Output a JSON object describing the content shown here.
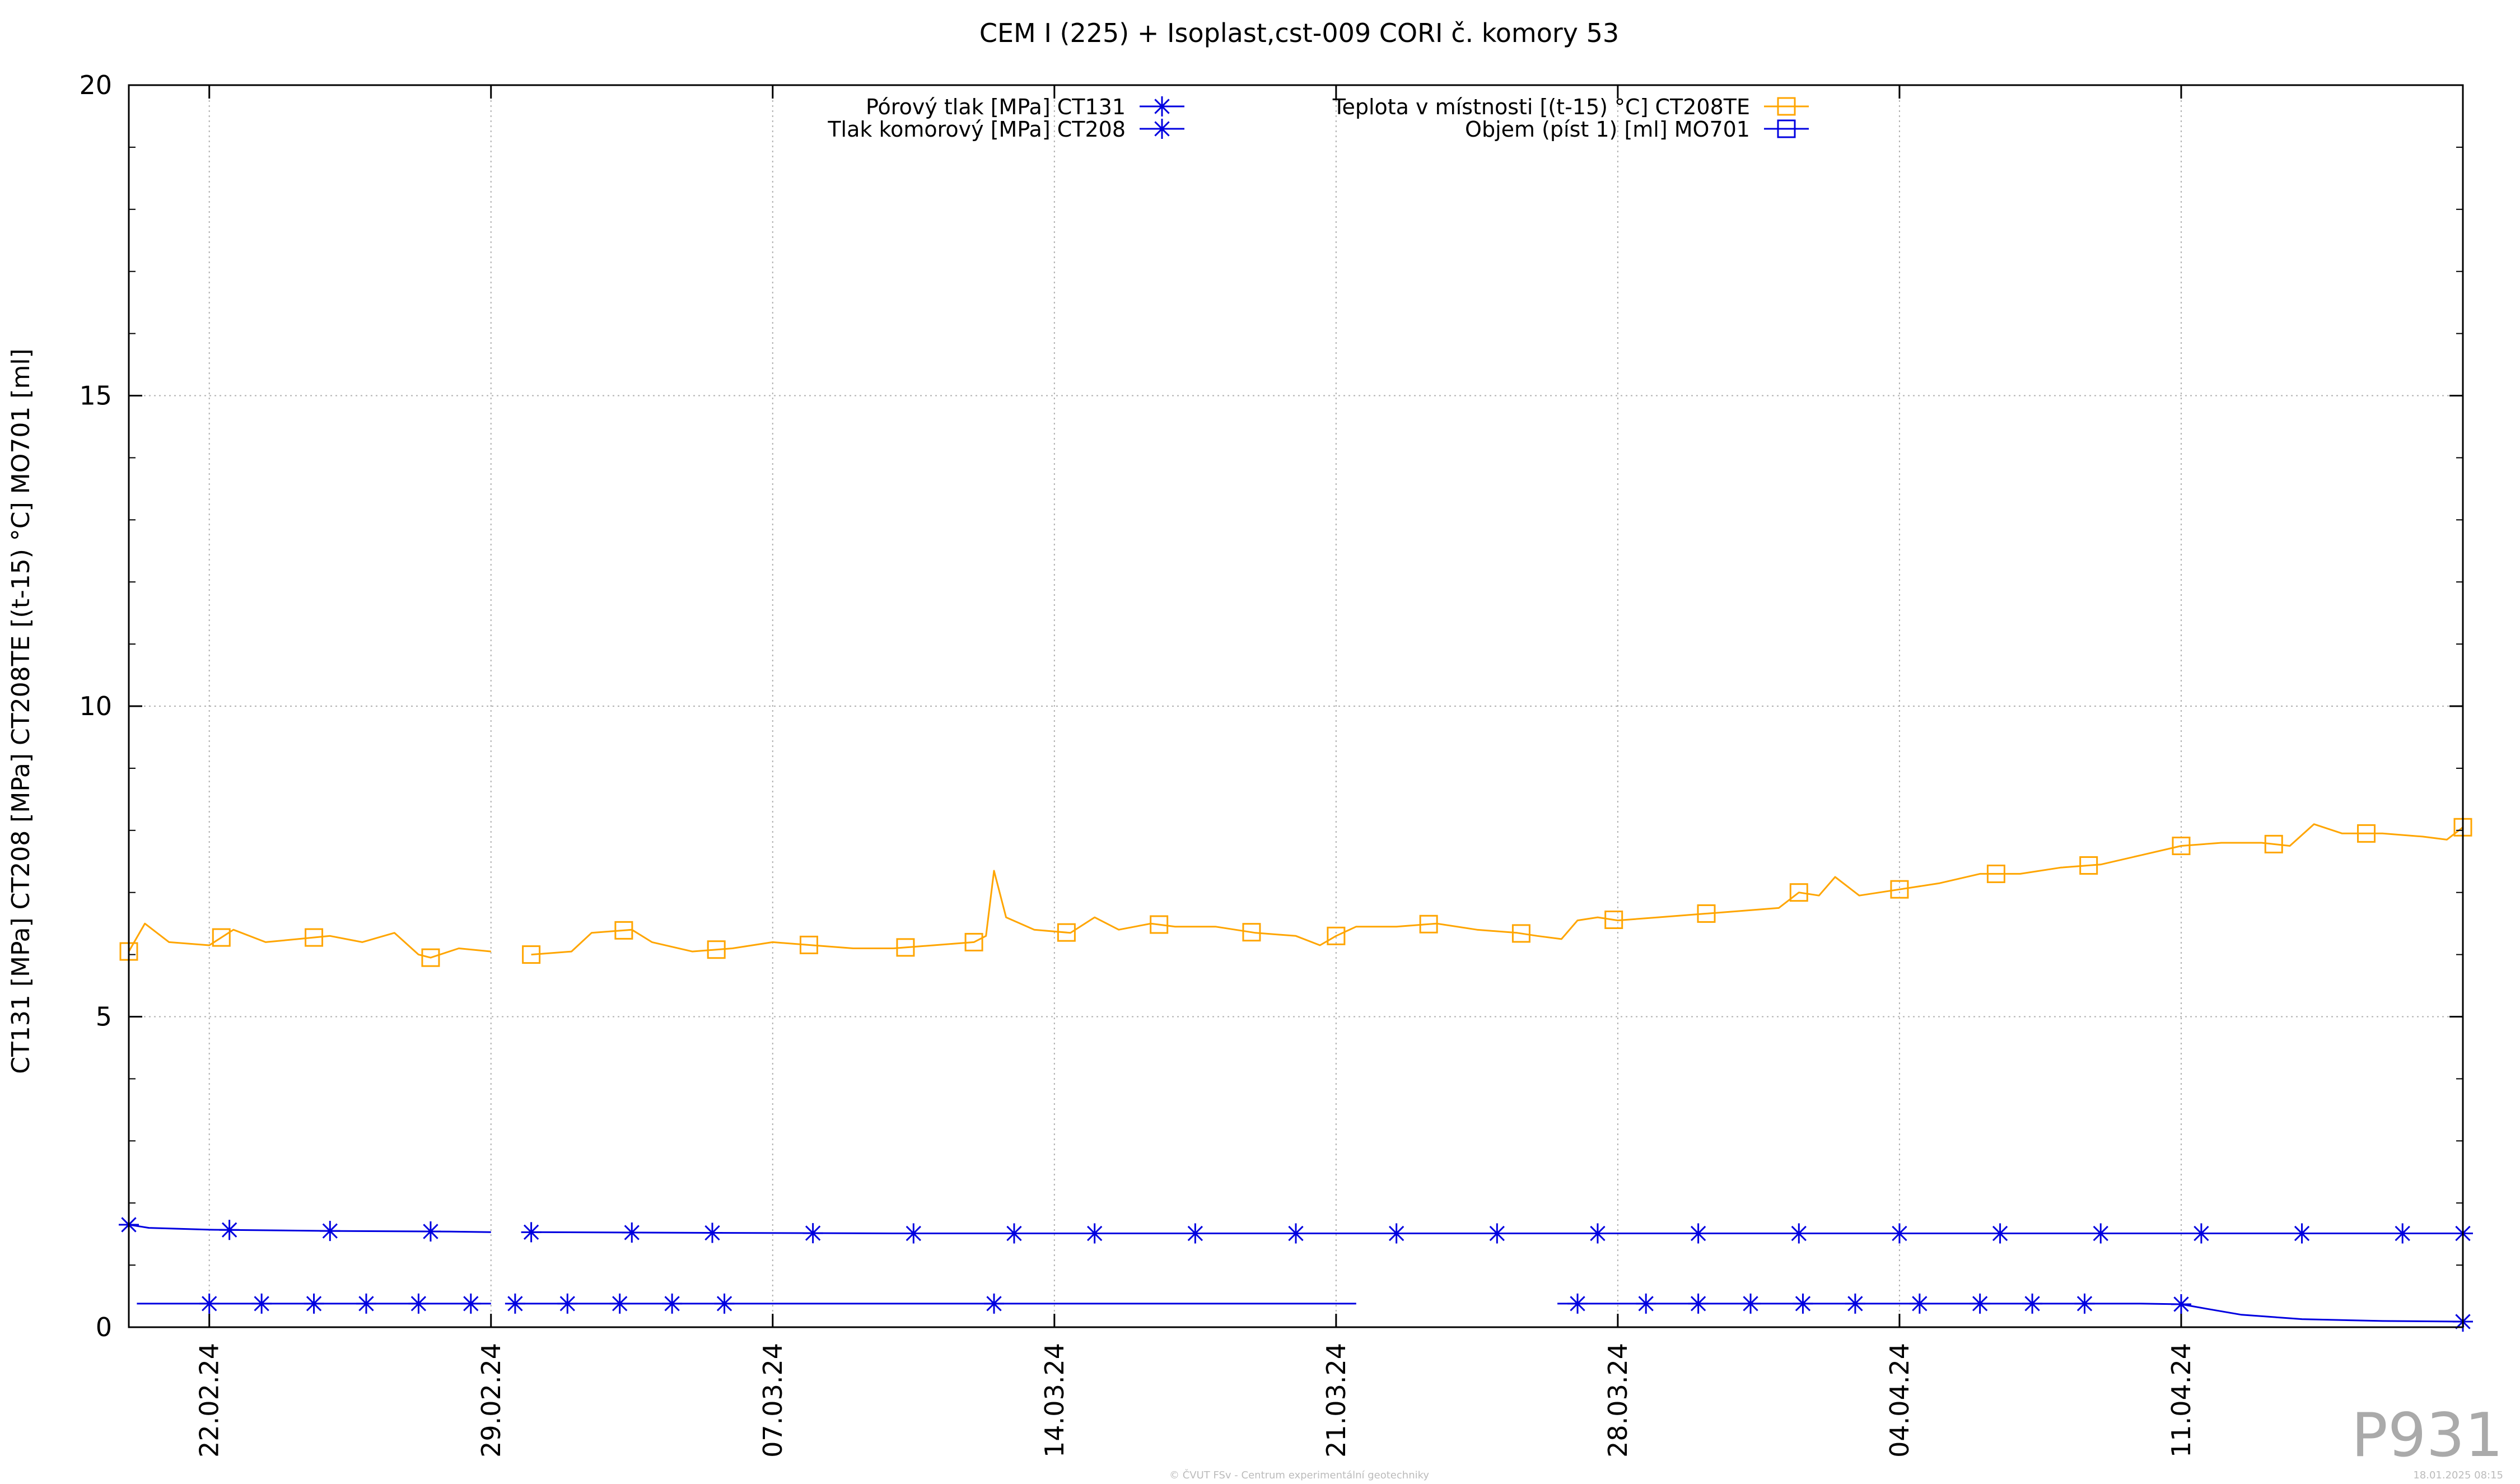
{
  "chart_data": {
    "type": "line",
    "title": "CEM I (225) + Isoplast,cst-009  CORI č. komory 53",
    "ylabel": "CT131 [MPa] CT208 [MPa] CT208TE [(t-15) °C] MO701 [ml]",
    "xlabel": "",
    "x_domain": [
      "2024-02-20",
      "2024-04-18"
    ],
    "ylim": [
      0,
      20
    ],
    "y_ticks": [
      0,
      5,
      10,
      15,
      20
    ],
    "x_ticks": [
      {
        "date": "2024-02-22",
        "label": "22.02.24"
      },
      {
        "date": "2024-02-29",
        "label": "29.02.24"
      },
      {
        "date": "2024-03-07",
        "label": "07.03.24"
      },
      {
        "date": "2024-03-14",
        "label": "14.03.24"
      },
      {
        "date": "2024-03-21",
        "label": "21.03.24"
      },
      {
        "date": "2024-03-28",
        "label": "28.03.24"
      },
      {
        "date": "2024-04-04",
        "label": "04.04.24"
      },
      {
        "date": "2024-04-11",
        "label": "11.04.24"
      }
    ],
    "grid": true,
    "legend_position": "top-center",
    "series": [
      {
        "name": "Pórový tlak [MPa] CT131",
        "color": "#0000e0",
        "marker": "asterisk",
        "legend_column": "left",
        "segments": [
          [
            [
              "2024-02-20",
              1.65
            ],
            [
              "2024-02-20.5",
              1.6
            ],
            [
              "2024-02-22",
              1.57
            ],
            [
              "2024-02-25",
              1.55
            ],
            [
              "2024-02-28",
              1.54
            ],
            [
              "2024-02-29",
              1.53
            ]
          ],
          [
            [
              "2024-03-01",
              1.53
            ],
            [
              "2024-03-05",
              1.52
            ],
            [
              "2024-03-10",
              1.51
            ],
            [
              "2024-03-15",
              1.51
            ],
            [
              "2024-03-20",
              1.51
            ],
            [
              "2024-03-25",
              1.51
            ],
            [
              "2024-04-01",
              1.51
            ],
            [
              "2024-04-08",
              1.51
            ],
            [
              "2024-04-14",
              1.51
            ],
            [
              "2024-04-18",
              1.51
            ]
          ]
        ],
        "markers_x": [
          "2024-02-20",
          "2024-02-22.5",
          "2024-02-25",
          "2024-02-27.5",
          "2024-03-01",
          "2024-03-03.5",
          "2024-03-05.5",
          "2024-03-08",
          "2024-03-10.5",
          "2024-03-13",
          "2024-03-15",
          "2024-03-17.5",
          "2024-03-20",
          "2024-03-22.5",
          "2024-03-25",
          "2024-03-27.5",
          "2024-03-30",
          "2024-04-01.5",
          "2024-04-04",
          "2024-04-06.5",
          "2024-04-09",
          "2024-04-11.5",
          "2024-04-14",
          "2024-04-16.5",
          "2024-04-18"
        ]
      },
      {
        "name": "Tlak komorový [MPa] CT208",
        "color": "#0000e0",
        "marker": "asterisk",
        "legend_column": "left",
        "segments": [
          [
            [
              "2024-02-20.2",
              0.38
            ],
            [
              "2024-02-29",
              0.38
            ]
          ],
          [
            [
              "2024-02-29.6",
              0.38
            ],
            [
              "2024-03-21.5",
              0.38
            ]
          ],
          [
            [
              "2024-03-26.5",
              0.38
            ],
            [
              "2024-04-10",
              0.38
            ],
            [
              "2024-04-11",
              0.37
            ],
            [
              "2024-04-11.6",
              0.3
            ],
            [
              "2024-04-12.5",
              0.2
            ],
            [
              "2024-04-14",
              0.13
            ],
            [
              "2024-04-16",
              0.1
            ],
            [
              "2024-04-18",
              0.09
            ],
            [
              "2024-04-18.01",
              0.0
            ]
          ]
        ],
        "markers_x": [
          "2024-02-22",
          "2024-02-23.3",
          "2024-02-24.6",
          "2024-02-25.9",
          "2024-02-27.2",
          "2024-02-28.5",
          "2024-02-29.6",
          "2024-03-01.9",
          "2024-03-03.2",
          "2024-03-04.5",
          "2024-03-05.8",
          "2024-03-12.5",
          "2024-03-27",
          "2024-03-28.7",
          "2024-03-30",
          "2024-03-31.3",
          "2024-04-01.6",
          "2024-04-02.9",
          "2024-04-04.5",
          "2024-04-06",
          "2024-04-07.3",
          "2024-04-08.6",
          "2024-04-11",
          "2024-04-18"
        ]
      },
      {
        "name": "Teplota v místnosti [(t-15) °C] CT208TE",
        "color": "#ffa500",
        "marker": "square",
        "legend_column": "right",
        "segments": [
          [
            [
              "2024-02-20",
              6.05
            ],
            [
              "2024-02-20.4",
              6.5
            ],
            [
              "2024-02-21",
              6.2
            ],
            [
              "2024-02-22",
              6.15
            ],
            [
              "2024-02-22.6",
              6.4
            ],
            [
              "2024-02-23.4",
              6.2
            ],
            [
              "2024-02-24.2",
              6.25
            ],
            [
              "2024-02-25",
              6.3
            ],
            [
              "2024-02-25.8",
              6.2
            ],
            [
              "2024-02-26.6",
              6.35
            ],
            [
              "2024-02-27.2",
              6.0
            ],
            [
              "2024-02-27.5",
              5.95
            ],
            [
              "2024-02-28.2",
              6.1
            ],
            [
              "2024-02-29",
              6.05
            ]
          ],
          [
            [
              "2024-03-01",
              6.0
            ],
            [
              "2024-03-02",
              6.05
            ],
            [
              "2024-03-02.5",
              6.35
            ],
            [
              "2024-03-03.5",
              6.4
            ],
            [
              "2024-03-04",
              6.2
            ],
            [
              "2024-03-05",
              6.05
            ],
            [
              "2024-03-06",
              6.1
            ],
            [
              "2024-03-07",
              6.2
            ],
            [
              "2024-03-08",
              6.15
            ],
            [
              "2024-03-09",
              6.1
            ],
            [
              "2024-03-10",
              6.1
            ],
            [
              "2024-03-11",
              6.15
            ],
            [
              "2024-03-12",
              6.2
            ],
            [
              "2024-03-12.3",
              6.3
            ],
            [
              "2024-03-12.5",
              7.35
            ],
            [
              "2024-03-12.8",
              6.6
            ],
            [
              "2024-03-13.5",
              6.4
            ],
            [
              "2024-03-14.4",
              6.35
            ],
            [
              "2024-03-15",
              6.6
            ],
            [
              "2024-03-15.6",
              6.4
            ],
            [
              "2024-03-16.4",
              6.5
            ],
            [
              "2024-03-17",
              6.45
            ],
            [
              "2024-03-18",
              6.45
            ],
            [
              "2024-03-19",
              6.35
            ],
            [
              "2024-03-20",
              6.3
            ],
            [
              "2024-03-20.6",
              6.15
            ],
            [
              "2024-03-21",
              6.3
            ],
            [
              "2024-03-21.5",
              6.45
            ],
            [
              "2024-03-22.5",
              6.45
            ],
            [
              "2024-03-23.5",
              6.5
            ],
            [
              "2024-03-24.5",
              6.4
            ],
            [
              "2024-03-25.5",
              6.35
            ],
            [
              "2024-03-26",
              6.3
            ],
            [
              "2024-03-26.6",
              6.25
            ],
            [
              "2024-03-27",
              6.55
            ],
            [
              "2024-03-27.5",
              6.6
            ],
            [
              "2024-03-28",
              6.55
            ],
            [
              "2024-03-29",
              6.6
            ],
            [
              "2024-03-30",
              6.65
            ],
            [
              "2024-03-31",
              6.7
            ],
            [
              "2024-04-01",
              6.75
            ],
            [
              "2024-04-01.5",
              7.0
            ],
            [
              "2024-04-02",
              6.95
            ],
            [
              "2024-04-02.4",
              7.25
            ],
            [
              "2024-04-03",
              6.95
            ],
            [
              "2024-04-04",
              7.05
            ],
            [
              "2024-04-05",
              7.15
            ],
            [
              "2024-04-06",
              7.3
            ],
            [
              "2024-04-07",
              7.3
            ],
            [
              "2024-04-08",
              7.4
            ],
            [
              "2024-04-09",
              7.45
            ],
            [
              "2024-04-10",
              7.6
            ],
            [
              "2024-04-11",
              7.75
            ],
            [
              "2024-04-12",
              7.8
            ],
            [
              "2024-04-13",
              7.8
            ],
            [
              "2024-04-13.7",
              7.75
            ],
            [
              "2024-04-14.3",
              8.1
            ],
            [
              "2024-04-15",
              7.95
            ],
            [
              "2024-04-16",
              7.95
            ],
            [
              "2024-04-17",
              7.9
            ],
            [
              "2024-04-17.6",
              7.85
            ],
            [
              "2024-04-18",
              8.05
            ]
          ]
        ],
        "markers_x": [
          "2024-02-20",
          "2024-02-22.3",
          "2024-02-24.6",
          "2024-02-27.5",
          "2024-03-01",
          "2024-03-03.3",
          "2024-03-05.6",
          "2024-03-07.9",
          "2024-03-10.3",
          "2024-03-12",
          "2024-03-14.3",
          "2024-03-16.6",
          "2024-03-18.9",
          "2024-03-21",
          "2024-03-23.3",
          "2024-03-25.6",
          "2024-03-27.9",
          "2024-03-30.2",
          "2024-04-01.5",
          "2024-04-04",
          "2024-04-06.4",
          "2024-04-08.7",
          "2024-04-11",
          "2024-04-13.3",
          "2024-04-15.6",
          "2024-04-18"
        ]
      },
      {
        "name": "Objem (píst 1) [ml] MO701",
        "color": "#0000e0",
        "marker": "open-square",
        "legend_column": "right",
        "segments": [],
        "markers_x": []
      }
    ]
  },
  "watermark": "P931",
  "footer_left": "© ČVUT FSv - Centrum experimentální geotechniky",
  "footer_right": "18.01.2025 08:15"
}
